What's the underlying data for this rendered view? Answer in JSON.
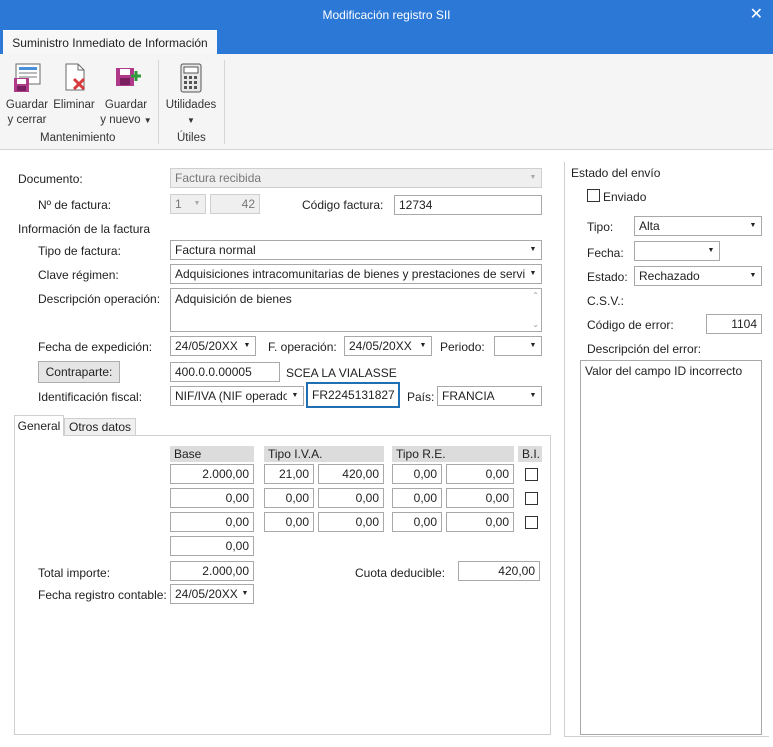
{
  "window": {
    "title": "Modificación registro SII",
    "close_symbol": "✕"
  },
  "ribbon": {
    "tab": "Suministro Inmediato de Información",
    "buttons": {
      "save_close": [
        "Guardar",
        "y cerrar"
      ],
      "delete": "Eliminar",
      "save_new": [
        "Guardar",
        "y nuevo"
      ],
      "utilities": "Utilidades"
    },
    "groups": {
      "maintenance": "Mantenimiento",
      "utils": "Útiles"
    }
  },
  "form": {
    "documento_label": "Documento:",
    "documento_value": "Factura recibida",
    "nfactura_label": "Nº de factura:",
    "nfactura_serie": "1",
    "nfactura_num": "42",
    "codigo_label": "Código factura:",
    "codigo_value": "12734",
    "info_header": "Información de la factura",
    "tipo_label": "Tipo de factura:",
    "tipo_value": "Factura normal",
    "clave_label": "Clave régimen:",
    "clave_value": "Adquisiciones intracomunitarias de bienes y prestaciones de servicios",
    "desc_label": "Descripción operación:",
    "desc_value": "Adquisición de bienes",
    "fexp_label": "Fecha de expedición:",
    "fexp_value": "24/05/20XX",
    "fop_label": "F. operación:",
    "fop_value": "24/05/20XX",
    "periodo_label": "Periodo:",
    "periodo_value": "",
    "contraparte_button": "Contraparte:",
    "contraparte_code": "400.0.0.00005",
    "contraparte_name": "SCEA LA VIALASSE",
    "idfiscal_label": "Identificación fiscal:",
    "idfiscal_type": "NIF/IVA (NIF operador",
    "idfiscal_value": "FR2245131827",
    "pais_label": "País:",
    "pais_value": "FRANCIA"
  },
  "tabs": [
    "General",
    "Otros datos"
  ],
  "table": {
    "headers": {
      "base": "Base",
      "iva": "Tipo I.V.A.",
      "re": "Tipo R.E.",
      "bi": "B.I."
    },
    "rows": [
      {
        "base": "2.000,00",
        "iva_pct": "21,00",
        "iva_amt": "420,00",
        "re_pct": "0,00",
        "re_amt": "0,00"
      },
      {
        "base": "0,00",
        "iva_pct": "0,00",
        "iva_amt": "0,00",
        "re_pct": "0,00",
        "re_amt": "0,00"
      },
      {
        "base": "0,00",
        "iva_pct": "0,00",
        "iva_amt": "0,00",
        "re_pct": "0,00",
        "re_amt": "0,00"
      }
    ],
    "extra_base": "0,00",
    "total_label": "Total importe:",
    "total_value": "2.000,00",
    "cuota_label": "Cuota deducible:",
    "cuota_value": "420,00",
    "fregistro_label": "Fecha registro contable:",
    "fregistro_value": "24/05/20XX"
  },
  "estado": {
    "header": "Estado del envío",
    "enviado_label": "Enviado",
    "tipo_label": "Tipo:",
    "tipo_value": "Alta",
    "fecha_label": "Fecha:",
    "fecha_value": "",
    "estado_label": "Estado:",
    "estado_value": "Rechazado",
    "csv_label": "C.S.V.:",
    "codigo_error_label": "Código de error:",
    "codigo_error_value": "1104",
    "desc_error_label": "Descripción del error:",
    "desc_error_value": "Valor del campo ID incorrecto"
  },
  "colors": {
    "accent": "#2b78d7",
    "focus_border": "#1f6fb2"
  }
}
